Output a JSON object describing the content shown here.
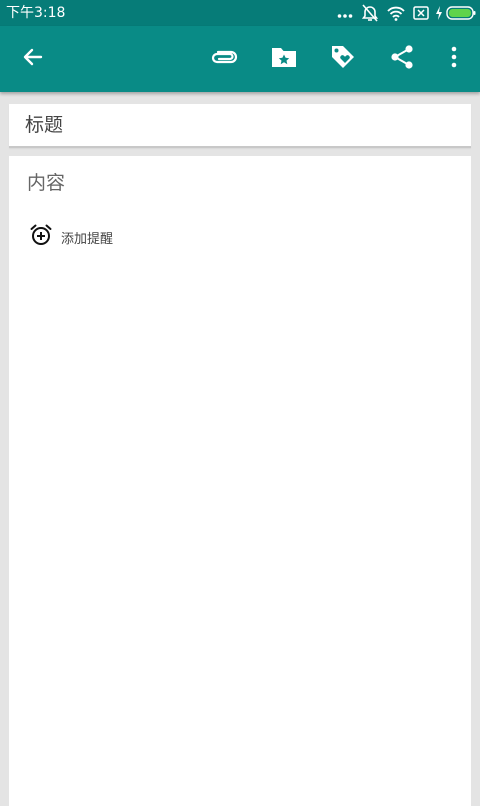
{
  "status_bar": {
    "time": "下午3:18",
    "icons": [
      "more-dots-icon",
      "alarm-off-icon",
      "wifi-icon",
      "sim-x-icon",
      "charging-bolt-icon",
      "battery-icon"
    ],
    "battery_color": "#5fd34a"
  },
  "toolbar": {
    "background": "#098b86",
    "icons": [
      "back-arrow-icon",
      "attachment-icon",
      "folder-star-icon",
      "tag-heart-icon",
      "share-icon",
      "more-vert-icon"
    ]
  },
  "note": {
    "title_placeholder": "标题",
    "content_placeholder": "内容",
    "reminder_label": "添加提醒"
  }
}
